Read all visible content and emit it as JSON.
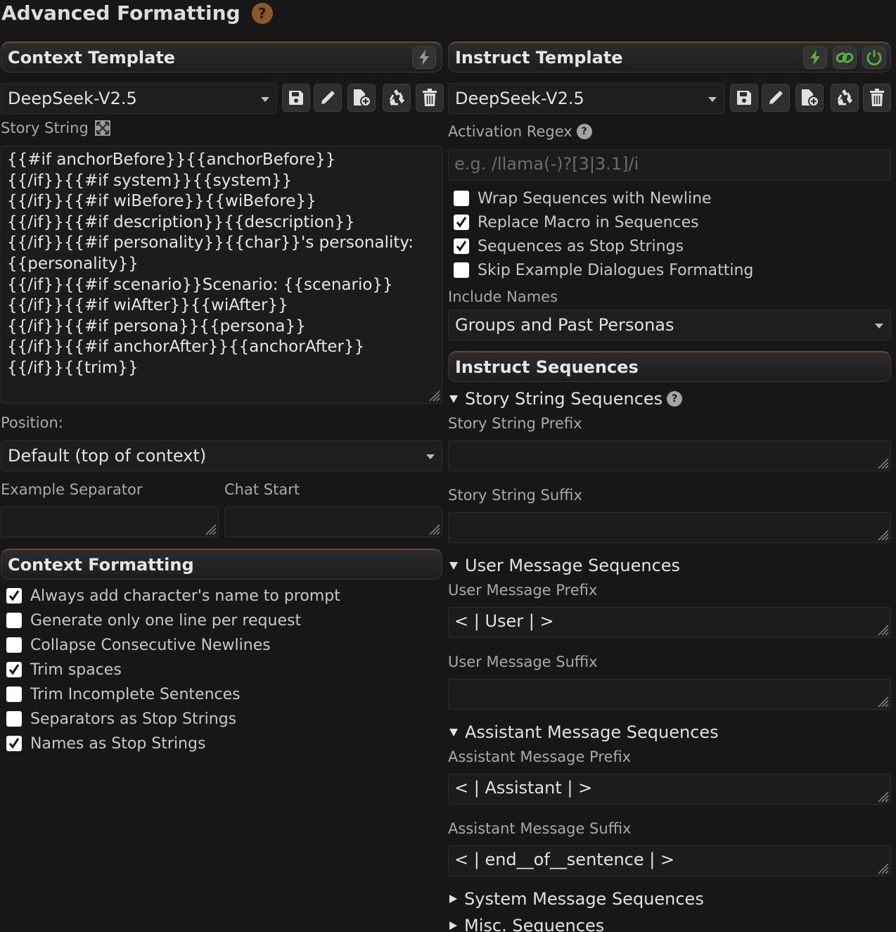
{
  "page": {
    "title": "Advanced Formatting",
    "help_icon": "?"
  },
  "context_template": {
    "header": "Context Template",
    "selected": "DeepSeek-V2.5",
    "story_string_label": "Story String",
    "story_string": "{{#if anchorBefore}}{{anchorBefore}}\n{{/if}}{{#if system}}{{system}}\n{{/if}}{{#if wiBefore}}{{wiBefore}}\n{{/if}}{{#if description}}{{description}}\n{{/if}}{{#if personality}}{{char}}'s personality:\n{{personality}}\n{{/if}}{{#if scenario}}Scenario: {{scenario}}\n{{/if}}{{#if wiAfter}}{{wiAfter}}\n{{/if}}{{#if persona}}{{persona}}\n{{/if}}{{#if anchorAfter}}{{anchorAfter}}\n{{/if}}{{trim}}",
    "position_label": "Position:",
    "position_value": "Default (top of context)",
    "example_separator_label": "Example Separator",
    "example_separator_value": "",
    "chat_start_label": "Chat Start",
    "chat_start_value": ""
  },
  "context_formatting": {
    "header": "Context Formatting",
    "options": [
      {
        "label": "Always add character's name to prompt",
        "checked": true
      },
      {
        "label": "Generate only one line per request",
        "checked": false
      },
      {
        "label": "Collapse Consecutive Newlines",
        "checked": false
      },
      {
        "label": "Trim spaces",
        "checked": true
      },
      {
        "label": "Trim Incomplete Sentences",
        "checked": false
      },
      {
        "label": "Separators as Stop Strings",
        "checked": false
      },
      {
        "label": "Names as Stop Strings",
        "checked": true
      }
    ]
  },
  "instruct_template": {
    "header": "Instruct Template",
    "selected": "DeepSeek-V2.5",
    "activation_regex_label": "Activation Regex",
    "activation_regex_placeholder": "e.g. /llama(-)?[3|3.1]/i",
    "options": [
      {
        "label": "Wrap Sequences with Newline",
        "checked": false
      },
      {
        "label": "Replace Macro in Sequences",
        "checked": true
      },
      {
        "label": "Sequences as Stop Strings",
        "checked": true
      },
      {
        "label": "Skip Example Dialogues Formatting",
        "checked": false
      }
    ],
    "include_names_label": "Include Names",
    "include_names_value": "Groups and Past Personas"
  },
  "instruct_sequences": {
    "header": "Instruct Sequences",
    "story_string_sequences": {
      "title": "Story String Sequences",
      "prefix_label": "Story String Prefix",
      "prefix_value": "",
      "suffix_label": "Story String Suffix",
      "suffix_value": ""
    },
    "user_message_sequences": {
      "title": "User Message Sequences",
      "prefix_label": "User Message Prefix",
      "prefix_value": "< | User | >",
      "suffix_label": "User Message Suffix",
      "suffix_value": ""
    },
    "assistant_message_sequences": {
      "title": "Assistant Message Sequences",
      "prefix_label": "Assistant Message Prefix",
      "prefix_value": "< | Assistant | >",
      "suffix_label": "Assistant Message Suffix",
      "suffix_value": "< | end__of__sentence | >"
    },
    "system_message_sequences": {
      "title": "System Message Sequences"
    },
    "misc_sequences": {
      "title": "Misc. Sequences"
    }
  },
  "colors": {
    "bg": "#171717",
    "accent_green": "#55b040",
    "help_orange": "#8a5a24"
  },
  "icons": {
    "header_context": "bolt-icon",
    "header_instruct": [
      "bolt-icon",
      "link-icon",
      "power-icon"
    ],
    "toolbar": [
      "save-icon",
      "rename-icon",
      "import-icon",
      "restore-icon",
      "delete-icon"
    ]
  }
}
